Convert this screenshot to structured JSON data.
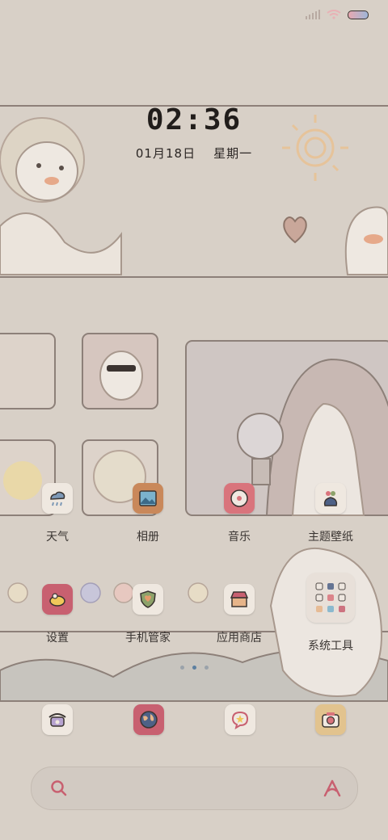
{
  "status_bar": {
    "signal_icon": "cell-signal-icon",
    "wifi_icon": "wifi-icon",
    "battery_icon": "battery-icon"
  },
  "clock": {
    "time": "02:36",
    "date": "01月18日",
    "weekday": "星期一"
  },
  "apps": [
    {
      "label": "天气",
      "icon": "weather-icon",
      "color": "#efe8e0"
    },
    {
      "label": "相册",
      "icon": "gallery-icon",
      "color": "#c9885a"
    },
    {
      "label": "音乐",
      "icon": "music-icon",
      "color": "#d9747c"
    },
    {
      "label": "主题壁纸",
      "icon": "themes-icon",
      "color": "#efe8e0"
    },
    {
      "label": "设置",
      "icon": "settings-icon",
      "color": "#c86070"
    },
    {
      "label": "手机管家",
      "icon": "security-icon",
      "color": "#efe8e0"
    },
    {
      "label": "应用商店",
      "icon": "app-store-icon",
      "color": "#efe8e0"
    },
    {
      "label": "系统工具",
      "icon": "folder-icon",
      "color": "#e8e0d8"
    }
  ],
  "dock": [
    {
      "name": "phone",
      "icon": "phone-icon",
      "color": "#efe8e0"
    },
    {
      "name": "browser",
      "icon": "browser-icon",
      "color": "#c86070"
    },
    {
      "name": "messages",
      "icon": "messages-icon",
      "color": "#efe8e0"
    },
    {
      "name": "camera",
      "icon": "camera-icon",
      "color": "#e2c38e"
    }
  ],
  "pager": {
    "pages": 3,
    "current": 1
  },
  "search": {
    "left_icon": "search-icon",
    "right_icon": "assistant-icon"
  }
}
